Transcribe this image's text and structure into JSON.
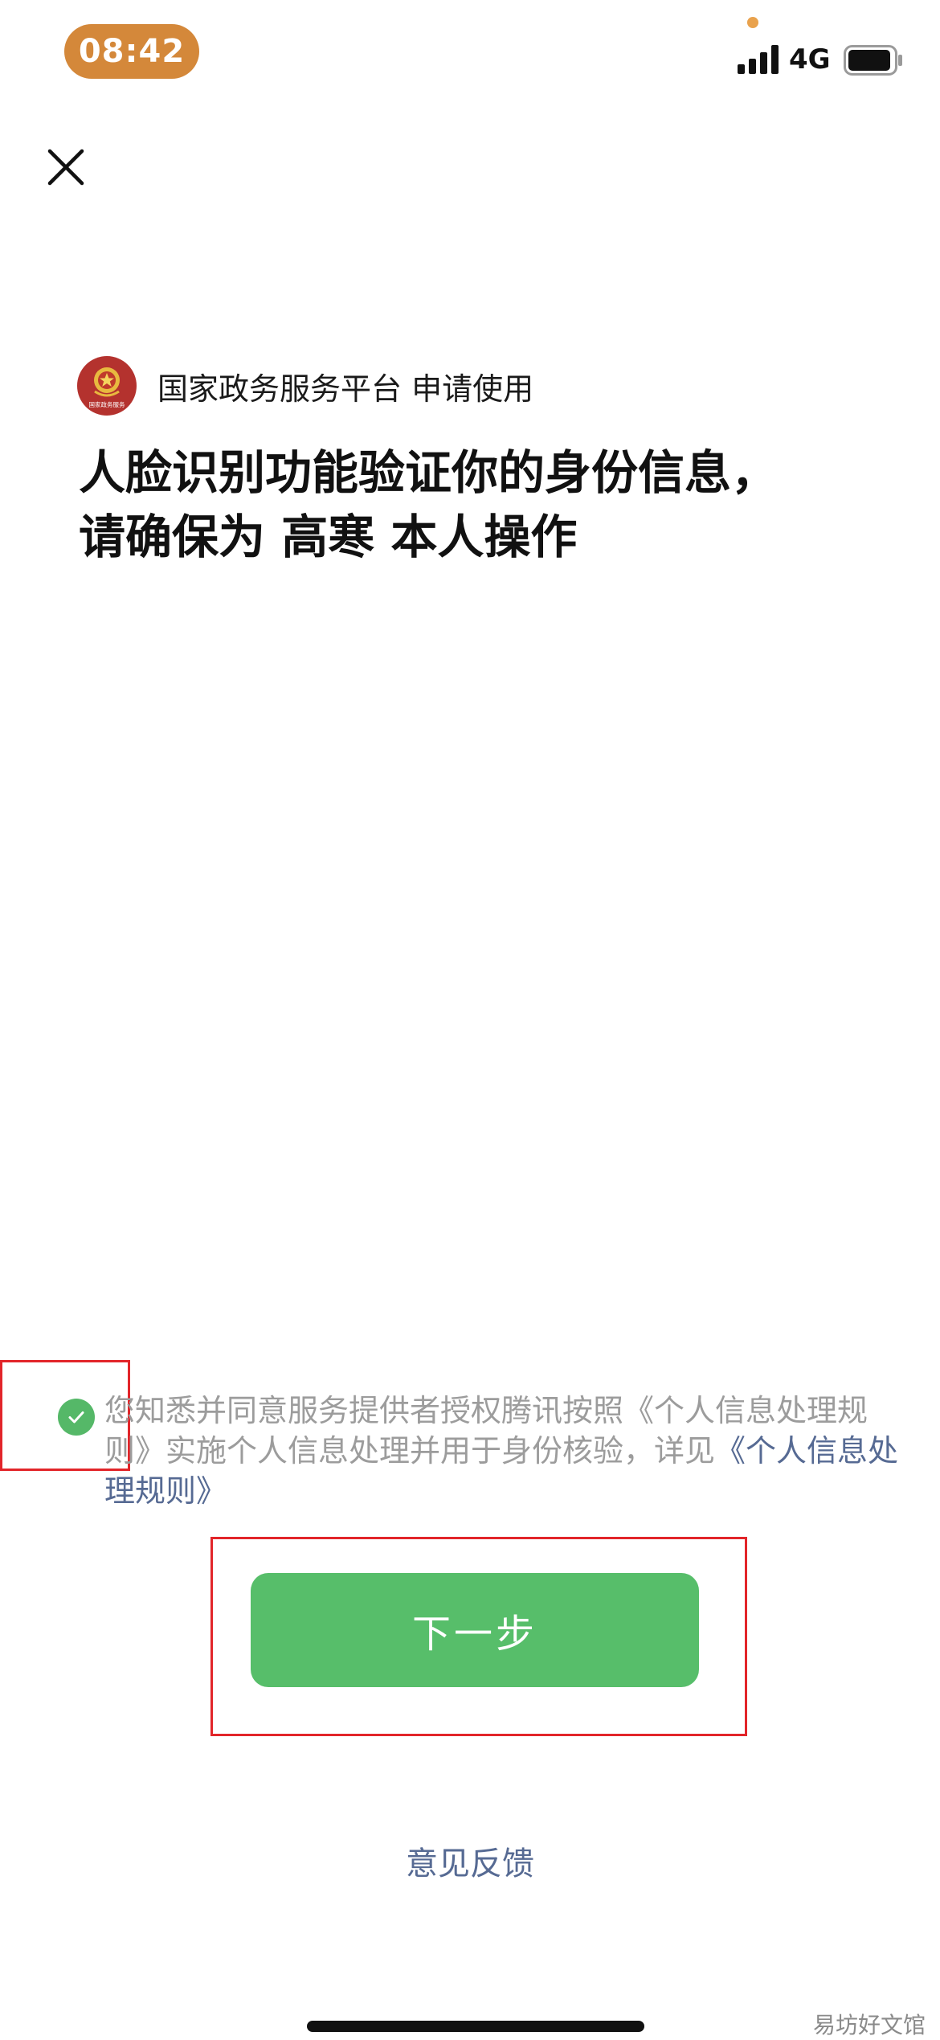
{
  "status_bar": {
    "time": "08:42",
    "network": "4G",
    "time_pill_color": "#d4883a",
    "icons": [
      "signal-icon",
      "battery-icon"
    ]
  },
  "requester": {
    "logo_icon": "national-emblem-logo",
    "logo_text": "国家政务服务",
    "text": "国家政务服务平台 申请使用"
  },
  "title": {
    "line1": "人脸识别功能验证你的身份信息，",
    "line2": "请确保为 高寒 本人操作"
  },
  "consent": {
    "checked": true,
    "text": "您知悉并同意服务提供者授权腾讯按照《个人信息处理规则》实施个人信息处理并用于身份核验，详见",
    "link": "《个人信息处理规则》",
    "check_color": "#55b868"
  },
  "next_button": {
    "label": "下一步",
    "color": "#57be6a"
  },
  "feedback": {
    "label": "意见反馈"
  },
  "watermark": {
    "text": "易坊好文馆"
  }
}
